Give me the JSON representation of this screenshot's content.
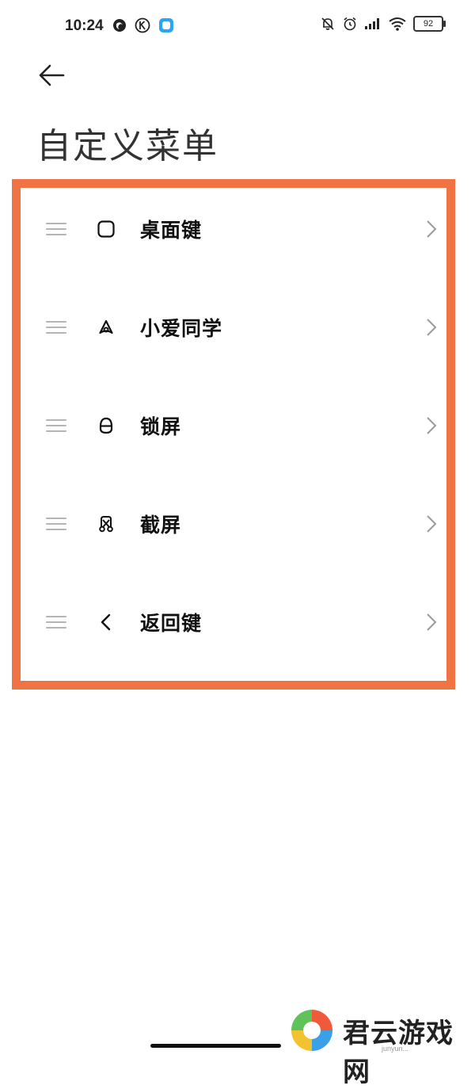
{
  "status_bar": {
    "time": "10:24",
    "left_icons": [
      "firefox-like-icon",
      "k-circle-icon",
      "app-square-icon"
    ],
    "right_icons": [
      "bell-off-icon",
      "alarm-icon",
      "signal-icon",
      "wifi-icon"
    ],
    "battery": "92"
  },
  "header": {
    "back_icon": "arrow-left-icon",
    "title": "自定义菜单"
  },
  "menu": {
    "items": [
      {
        "label": "桌面键",
        "icon": "home-square-icon"
      },
      {
        "label": "小爱同学",
        "icon": "xiaoai-icon"
      },
      {
        "label": "锁屏",
        "icon": "lock-icon"
      },
      {
        "label": "截屏",
        "icon": "screenshot-scissors-icon"
      },
      {
        "label": "返回键",
        "icon": "back-chevron-icon"
      }
    ]
  },
  "highlight_color": "#f07344",
  "watermark": {
    "text": "君云游戏网",
    "sub": "junyun..."
  }
}
